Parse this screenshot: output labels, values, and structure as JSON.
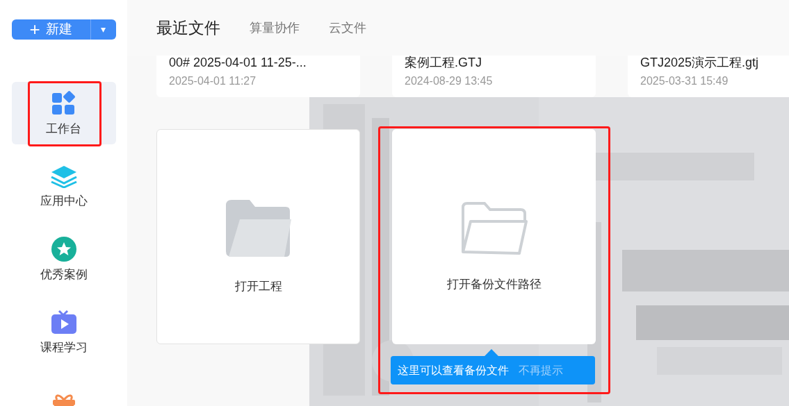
{
  "new_button": {
    "plus": "+",
    "label": "新建",
    "caret": "▾"
  },
  "sidebar": {
    "items": [
      {
        "label": "工作台",
        "kind": "grid",
        "selected": true,
        "highlighted": true
      },
      {
        "label": "应用中心",
        "kind": "layers",
        "selected": false,
        "highlighted": false
      },
      {
        "label": "优秀案例",
        "kind": "star",
        "selected": false,
        "highlighted": false
      },
      {
        "label": "课程学习",
        "kind": "tv",
        "selected": false,
        "highlighted": false
      },
      {
        "kind": "gift",
        "selected": false,
        "highlighted": false
      }
    ]
  },
  "tabs": [
    {
      "label": "最近文件",
      "selected": true
    },
    {
      "label": "算量协作",
      "selected": false
    },
    {
      "label": "云文件",
      "selected": false
    }
  ],
  "recent_files": [
    {
      "name": "00# 2025-04-01 11-25-...",
      "time": "2025-04-01 11:27"
    },
    {
      "name": "案例工程.GTJ",
      "time": "2024-08-29 13:45"
    },
    {
      "name": "GTJ2025演示工程.gtj",
      "time": "2025-03-31 15:49"
    }
  ],
  "actions": [
    {
      "label": "打开工程",
      "kind": "filled",
      "highlighted": false
    },
    {
      "label": "打开备份文件路径",
      "kind": "outline",
      "highlighted": true,
      "tooltip": {
        "text": "这里可以查看备份文件",
        "dismiss": "不再提示"
      }
    }
  ]
}
